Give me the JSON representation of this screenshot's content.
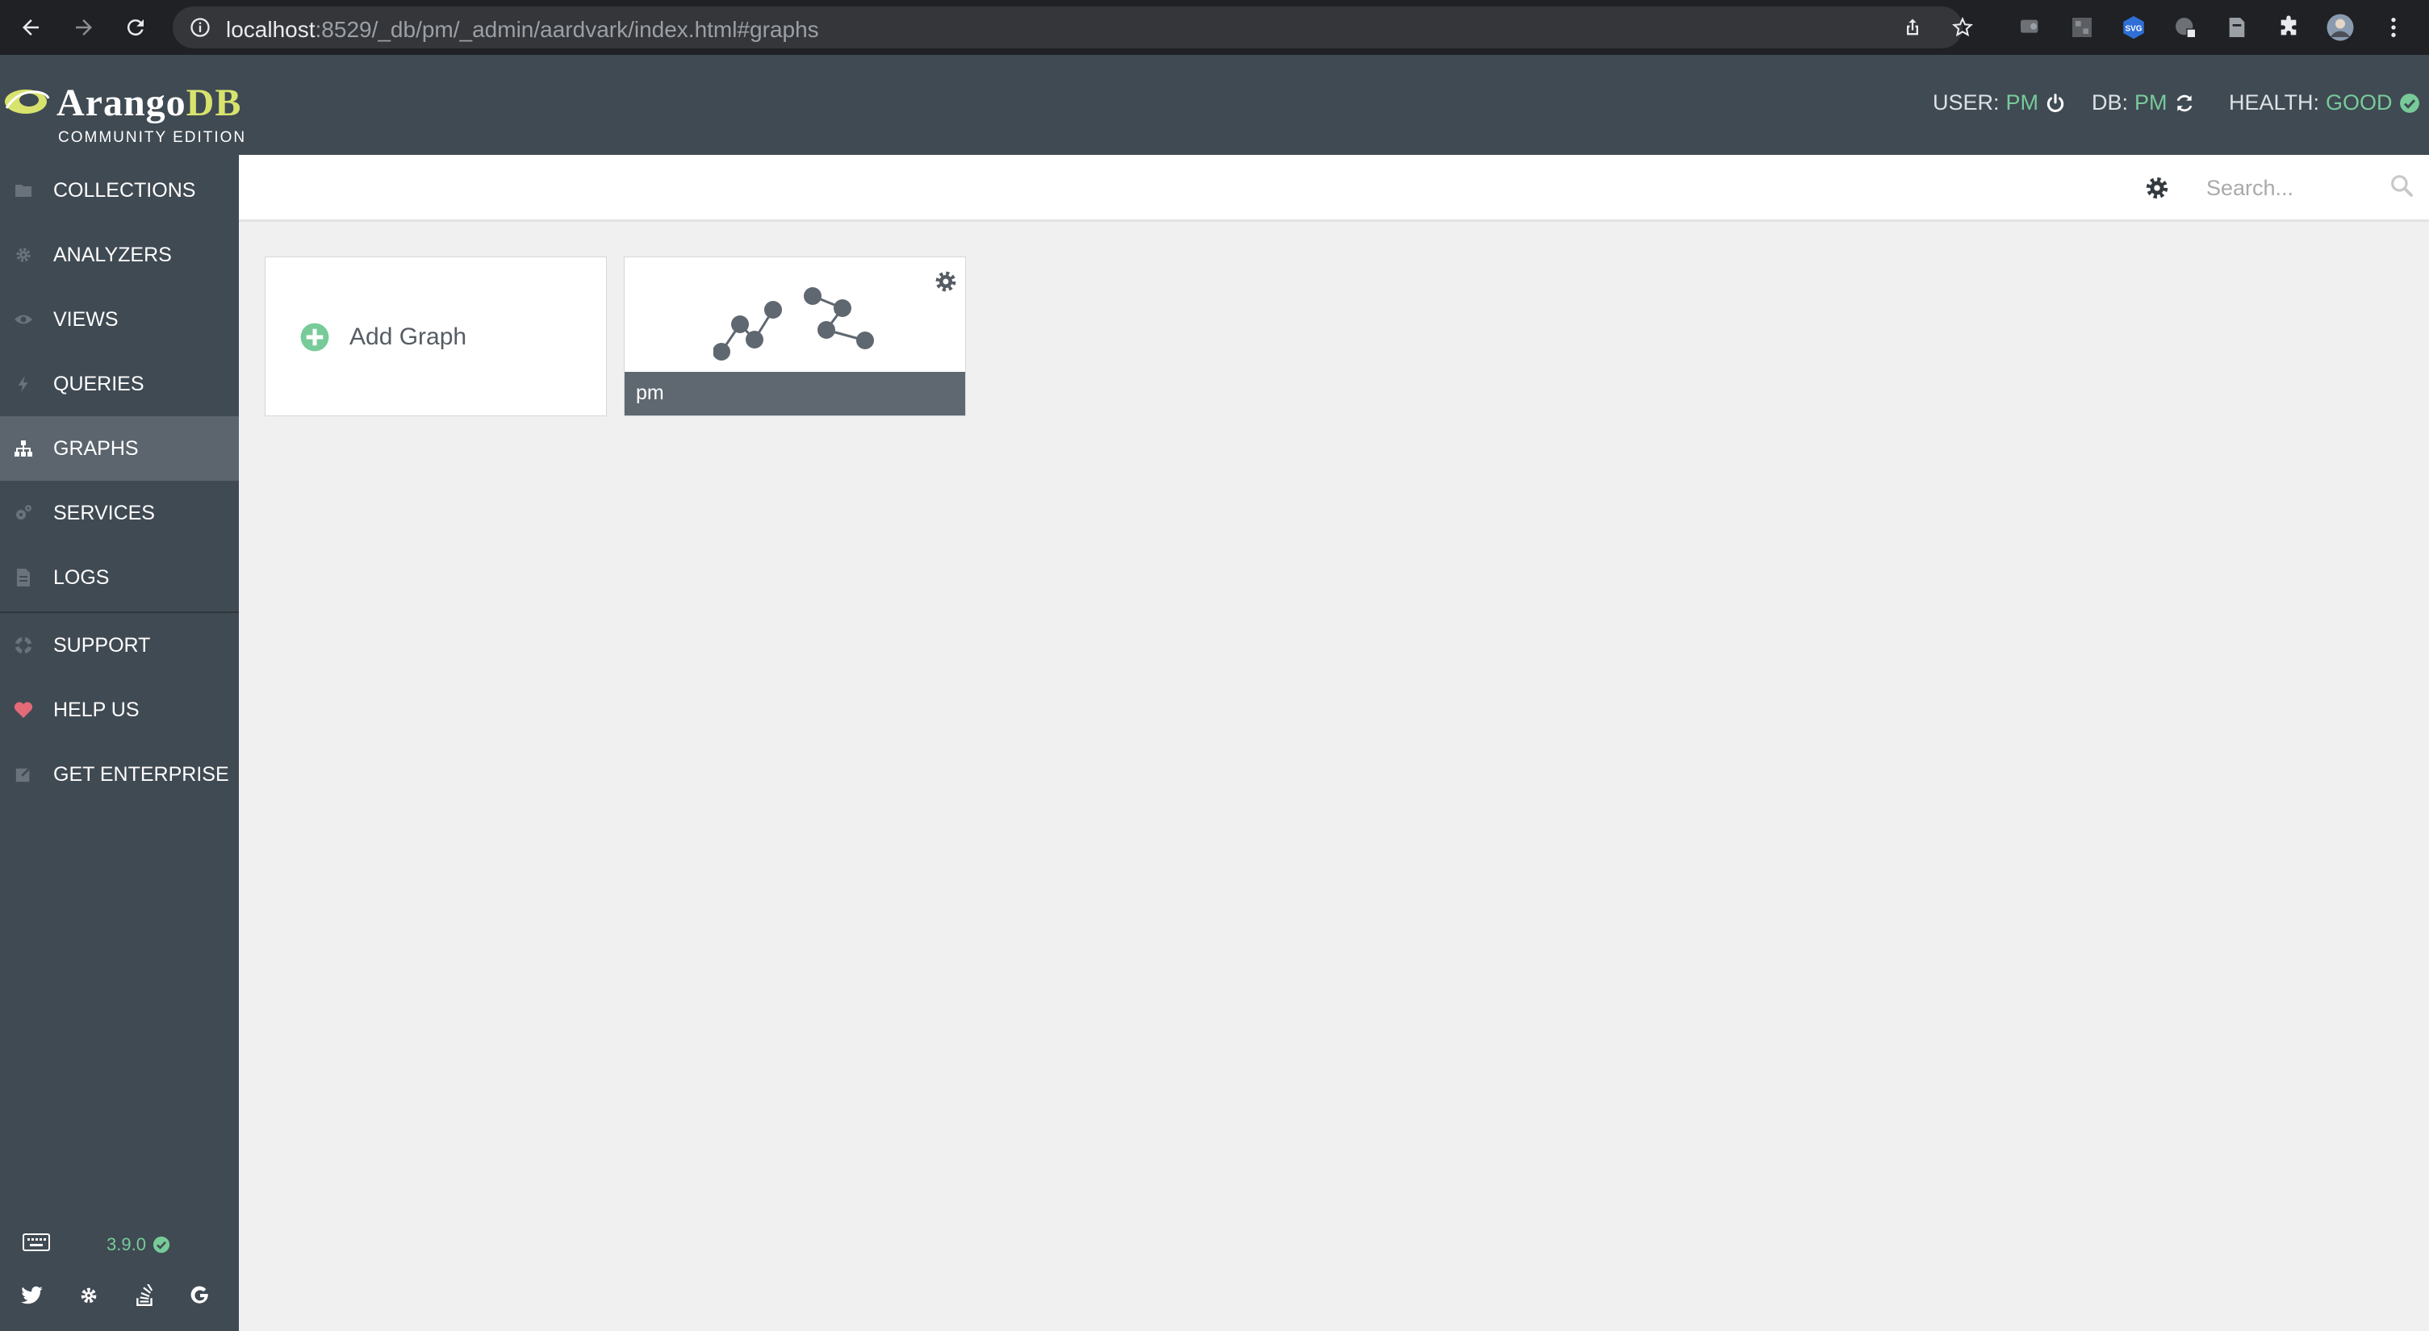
{
  "browser": {
    "url_host": "localhost",
    "url_path": ":8529/_db/pm/_admin/aardvark/index.html#graphs",
    "icons": [
      "back-icon",
      "forward-icon",
      "reload-icon",
      "info-icon",
      "share-icon",
      "star-icon",
      "extension-icons",
      "puzzle-icon",
      "profile-avatar",
      "kebab-menu-icon"
    ],
    "extension_svg_label": "SVG"
  },
  "header": {
    "logo_main": "Arango",
    "logo_accent": "DB",
    "edition": "COMMUNITY EDITION",
    "user_label": "USER:",
    "user_value": "PM",
    "db_label": "DB:",
    "db_value": "PM",
    "health_label": "HEALTH:",
    "health_value": "GOOD",
    "accent_color": "#77cb99"
  },
  "sidebar": {
    "items": [
      {
        "label": "COLLECTIONS",
        "icon": "folder-icon"
      },
      {
        "label": "ANALYZERS",
        "icon": "cog-icon"
      },
      {
        "label": "VIEWS",
        "icon": "eye-icon"
      },
      {
        "label": "QUERIES",
        "icon": "bolt-icon"
      },
      {
        "label": "GRAPHS",
        "icon": "sitemap-icon",
        "active": true
      },
      {
        "label": "SERVICES",
        "icon": "cogs-icon"
      },
      {
        "label": "LOGS",
        "icon": "file-icon"
      },
      {
        "label": "SUPPORT",
        "icon": "life-ring-icon"
      },
      {
        "label": "HELP US",
        "icon": "heart-icon"
      },
      {
        "label": "GET ENTERPRISE",
        "icon": "external-link-icon"
      }
    ],
    "version": "3.9.0",
    "footer_icons": [
      "keyboard-icon",
      "twitter-icon",
      "slack-icon",
      "stack-overflow-icon",
      "google-icon"
    ]
  },
  "toolbar": {
    "search_placeholder": "Search..."
  },
  "graphs": {
    "add_label": "Add Graph",
    "items": [
      {
        "name": "pm"
      }
    ]
  }
}
